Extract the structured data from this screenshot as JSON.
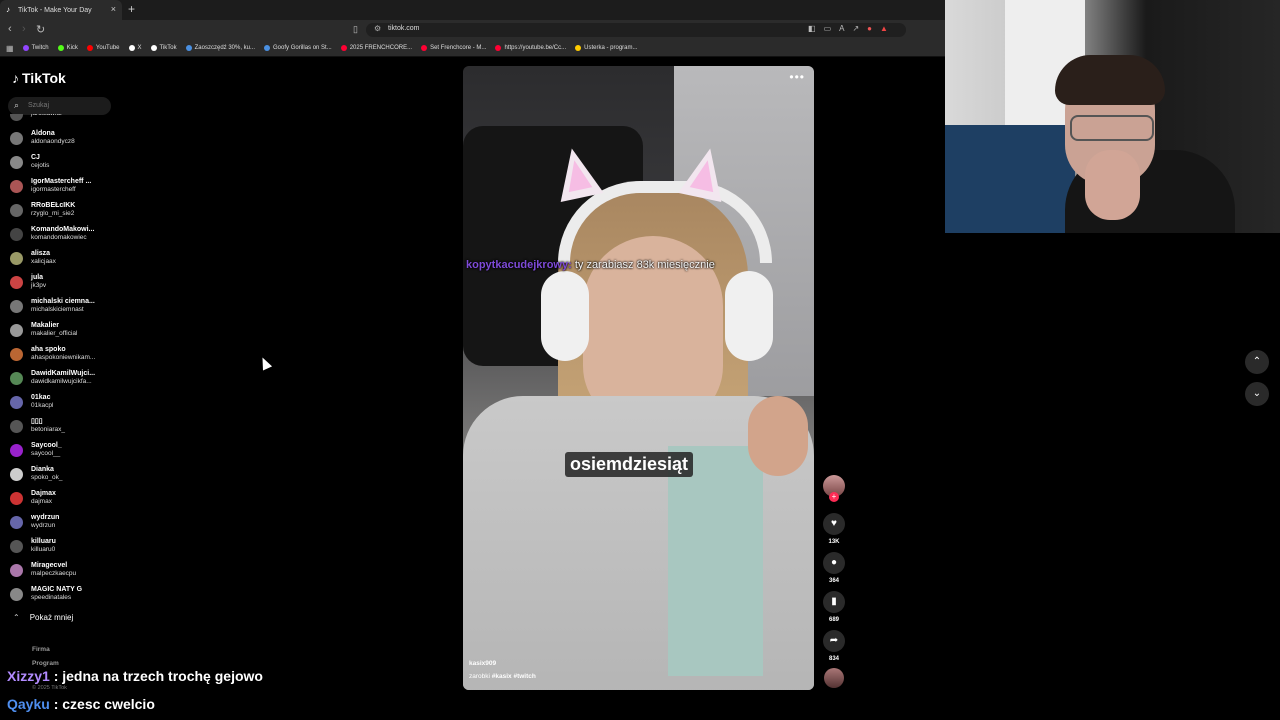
{
  "browser": {
    "tab_title": "TikTok - Make Your Day",
    "tab_close": "×",
    "new_tab": "+",
    "url": "tiktok.com",
    "bookmarks": [
      {
        "label": "Twitch",
        "color": "#9146ff"
      },
      {
        "label": "Kick",
        "color": "#53fc18"
      },
      {
        "label": "YouTube",
        "color": "#ff0000"
      },
      {
        "label": "X",
        "color": "#ffffff"
      },
      {
        "label": "TikTok",
        "color": "#ffffff"
      },
      {
        "label": "Zaoszczędź 30%, ku...",
        "color": "#4a90e2"
      },
      {
        "label": "Goofy Gorillas on St...",
        "color": "#4a90e2"
      },
      {
        "label": "2025 FRENCHCORE...",
        "color": "#ff0033"
      },
      {
        "label": "Set Frenchcore - M...",
        "color": "#ff0033"
      },
      {
        "label": "https://youtube.be/Cc...",
        "color": "#ff0033"
      },
      {
        "label": "Usterka - program...",
        "color": "#ffcc00"
      }
    ]
  },
  "tiktok": {
    "logo": "TikTok",
    "search_placeholder": "Szukaj",
    "following": [
      {
        "name": "",
        "username": "jaroslawk2"
      },
      {
        "name": "Aldona",
        "username": "aldonaondycz8"
      },
      {
        "name": "CJ",
        "username": "cejotis"
      },
      {
        "name": "IgorMastercheff ...",
        "username": "igormastercheff"
      },
      {
        "name": "RRoBEŁcIKK",
        "username": "rzyglo_mi_sie2"
      },
      {
        "name": "KomandoMakowi...",
        "username": "komandomakowiec"
      },
      {
        "name": "alisza",
        "username": "xalicjaax"
      },
      {
        "name": "jula",
        "username": "jk3pv"
      },
      {
        "name": "michalski ciemna...",
        "username": "michalskiciemnast"
      },
      {
        "name": "Makalier",
        "username": "makalier_official"
      },
      {
        "name": "aha spoko",
        "username": "ahaspokoniewnikam..."
      },
      {
        "name": "DawidKamilWujci...",
        "username": "dawidkamilwujcikfa..."
      },
      {
        "name": "01kac",
        "username": "01kacpl"
      },
      {
        "name": "▯▯▯",
        "username": "betoniarax_"
      },
      {
        "name": "Saycool_",
        "username": "saycool__"
      },
      {
        "name": "Dianka",
        "username": "spoko_ok_"
      },
      {
        "name": "Dajmax",
        "username": "dajmax"
      },
      {
        "name": "wydrzun",
        "username": "wydrzun"
      },
      {
        "name": "killuaru",
        "username": "killuaru0"
      },
      {
        "name": "Miragecvel",
        "username": "malpeczkaecpu"
      },
      {
        "name": "MAGIC NATY G",
        "username": "speedinatales"
      }
    ],
    "avatar_colors": [
      "#555",
      "#777",
      "#888",
      "#a55",
      "#666",
      "#444",
      "#996",
      "#c44",
      "#777",
      "#999",
      "#b63",
      "#585",
      "#66a",
      "#555",
      "#92c",
      "#ccc",
      "#c33",
      "#66a",
      "#555",
      "#a7a",
      "#888"
    ],
    "show_less": "Pokaż mniej",
    "footer": [
      "Firma",
      "Program"
    ],
    "copyright": "© 2025 TikTok",
    "video": {
      "chat_user": "kopytkacudejkrowy:",
      "chat_message": "ty zarabiasz 83k miesięcznie",
      "caption": "osiemdziesiąt",
      "author": "kasix909",
      "desc_plain": "zarobki",
      "desc_tags": "#kasix #twitch"
    },
    "actions": {
      "likes": "13K",
      "comments": "364",
      "saves": "689",
      "shares": "834"
    }
  },
  "stream_chat": [
    {
      "user": "Xizzy1 ",
      "message": ": jedna na trzech trochę gejowo"
    },
    {
      "user": "Qayku",
      "message": " : czesc cwelcio"
    }
  ]
}
